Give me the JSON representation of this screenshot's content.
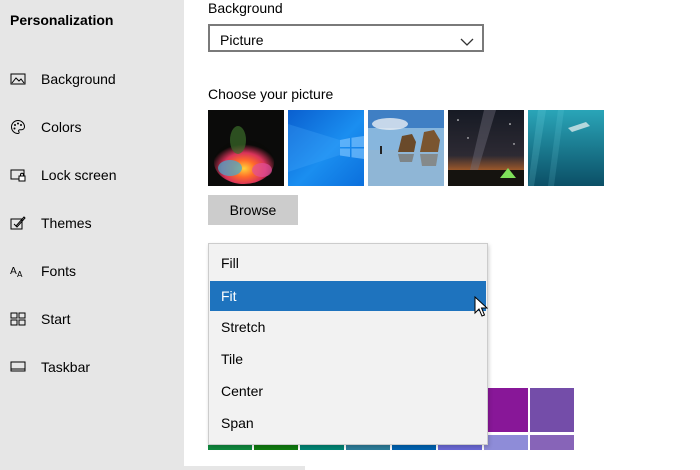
{
  "sidebar": {
    "title": "Personalization",
    "items": [
      {
        "label": "Background",
        "icon": "picture-icon"
      },
      {
        "label": "Colors",
        "icon": "palette-icon"
      },
      {
        "label": "Lock screen",
        "icon": "lock-screen-icon"
      },
      {
        "label": "Themes",
        "icon": "themes-icon"
      },
      {
        "label": "Fonts",
        "icon": "fonts-icon"
      },
      {
        "label": "Start",
        "icon": "start-icon"
      },
      {
        "label": "Taskbar",
        "icon": "taskbar-icon"
      }
    ]
  },
  "main": {
    "background_label": "Background",
    "background_select": {
      "value": "Picture"
    },
    "choose_picture_label": "Choose your picture",
    "thumbnails": [
      {
        "name": "color-powder"
      },
      {
        "name": "windows-blue"
      },
      {
        "name": "beach-rocks"
      },
      {
        "name": "night-sky-tent"
      },
      {
        "name": "underwater-swimmer"
      }
    ],
    "browse_label": "Browse",
    "fit_dropdown": {
      "options": [
        "Fill",
        "Fit",
        "Stretch",
        "Tile",
        "Center",
        "Span"
      ],
      "selected": "Fit"
    }
  },
  "colors": {
    "accent": "#1e73be",
    "sidebar_bg": "#e6e6e6",
    "swatches_row1": [
      "#881798",
      "#744da9"
    ],
    "swatches_row2": [
      "#10893e",
      "#107c10",
      "#018574",
      "#2d7d9a",
      "#0063b1",
      "#6b69d6",
      "#8e8cd8",
      "#8764b8"
    ]
  }
}
